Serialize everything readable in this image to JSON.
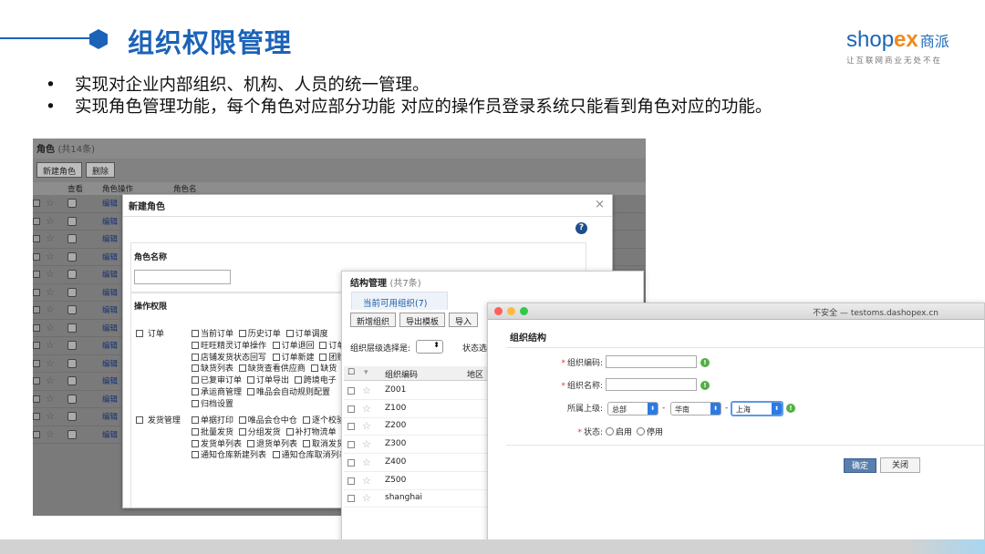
{
  "slide": {
    "title": "组织权限管理",
    "bullets": [
      "实现对企业内部组织、机构、人员的统一管理。",
      "实现角色管理功能，每个角色对应部分功能 对应的操作员登录系统只能看到角色对应的功能。"
    ]
  },
  "logo": {
    "brand_prefix": "shop",
    "brand_x": "ex",
    "brand_cn": "商派",
    "tagline": "让互联网商业无处不在"
  },
  "role_window": {
    "title": "角色",
    "count": "(共14条)",
    "buttons": [
      "新建角色",
      "删除"
    ],
    "columns": [
      "查看",
      "角色操作",
      "角色名"
    ],
    "edit_label": "编辑",
    "rows": 14
  },
  "new_role_modal": {
    "title": "新建角色",
    "close": "×",
    "help": "?",
    "role_name_label": "角色名称",
    "permissions_label": "操作权限",
    "groups": [
      {
        "name": "订单",
        "options": [
          [
            "当前订单",
            "历史订单",
            "订单调度"
          ],
          [
            "旺旺精灵订单操作",
            "订单退回",
            "订单"
          ],
          [
            "店铺发货状态回写",
            "订单新建",
            "团购"
          ],
          [
            "缺货列表",
            "缺货查看供应商",
            "缺货"
          ],
          [
            "已复审订单",
            "订单导出",
            "跨境电子"
          ],
          [
            "承运商管理",
            "唯品会自动规则配置"
          ],
          [
            "归档设置"
          ]
        ]
      },
      {
        "name": "发货管理",
        "options": [
          [
            "单据打印",
            "唯品会仓中仓",
            "逐个校验"
          ],
          [
            "批量发货",
            "分组发货",
            "补打物流单"
          ],
          [
            "发货单列表",
            "退货单列表",
            "取消发货"
          ],
          [
            "通知仓库新建列表",
            "通知仓库取消列表"
          ]
        ]
      }
    ]
  },
  "structure_window": {
    "title": "结构管理",
    "count": "(共7条)",
    "tab": "当前可用组织(7)",
    "buttons": [
      "新增组织",
      "导出模板",
      "导入"
    ],
    "filter_label": "组织层级选择是:",
    "status_label": "状态选",
    "columns": [
      "组织编码",
      "地区"
    ],
    "codes": [
      "Z001",
      "Z100",
      "Z200",
      "Z300",
      "Z400",
      "Z500",
      "shanghai"
    ]
  },
  "org_window": {
    "url": "不安全 — testoms.dashopex.cn",
    "title": "组织结构",
    "fields": {
      "code_label": "组织编码:",
      "name_label": "组织名称:",
      "parent_label": "所属上级:",
      "status_label": "状态:"
    },
    "parent_selects": [
      "总部",
      "华南",
      "上海"
    ],
    "status_options": [
      "启用",
      "停用"
    ],
    "confirm": "确定",
    "close": "关闭"
  }
}
